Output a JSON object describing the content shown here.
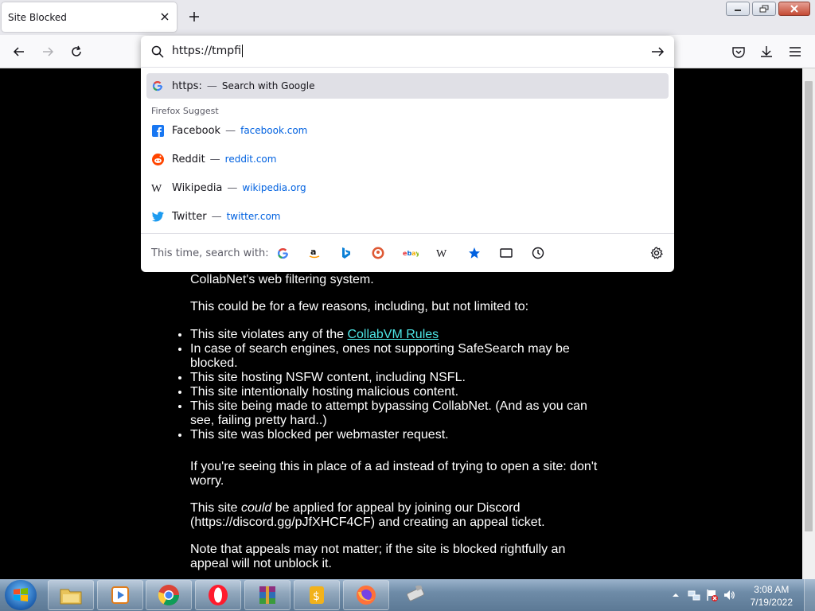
{
  "tab": {
    "title": "Site Blocked"
  },
  "url": {
    "value": "https://tmpfi"
  },
  "suggest": {
    "first": {
      "title": "https:",
      "action": "Search with Google"
    },
    "group_label": "Firefox Suggest",
    "items": [
      {
        "title": "Facebook",
        "url": "facebook.com"
      },
      {
        "title": "Reddit",
        "url": "reddit.com"
      },
      {
        "title": "Wikipedia",
        "url": "wikipedia.org"
      },
      {
        "title": "Twitter",
        "url": "twitter.com"
      }
    ],
    "oneoff_label": "This time, search with:"
  },
  "page": {
    "p1": "CollabNet's web filtering system.",
    "p2": "This could be for a few reasons, including, but not limited to:",
    "li1_pre": "This site violates any of the ",
    "li1_link": "CollabVM Rules",
    "li2": "In case of search engines, ones not supporting SafeSearch may be blocked.",
    "li3": "This site hosting NSFW content, including NSFL.",
    "li4": "This site intentionally hosting malicious content.",
    "li5": "This site being made to attempt bypassing CollabNet. (And as you can see, failing pretty hard..)",
    "li6": "This site was blocked per webmaster request.",
    "p3": "If you're seeing this in place of a ad instead of trying to open a site: don't worry.",
    "p4_pre": "This site ",
    "p4_em": "could",
    "p4_post": " be applied for appeal by joining our Discord (https://discord.gg/pJfXHCF4CF) and creating an appeal ticket.",
    "p5": "Note that appeals may not matter; if the site is blocked rightfully an appeal will not unblock it."
  },
  "clock": {
    "time": "3:08 AM",
    "date": "7/19/2022"
  }
}
